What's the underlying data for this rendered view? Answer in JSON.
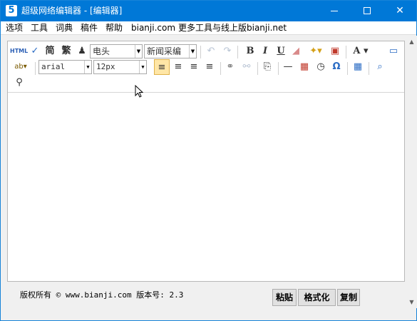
{
  "window": {
    "title": "超级网络编辑器 - [编辑器]",
    "app_icon_glyph": "5",
    "minimize_icon": "minimize-icon",
    "maximize_icon": "maximize-icon",
    "close_glyph": "✕"
  },
  "menubar": {
    "items": [
      "选项",
      "工具",
      "词典",
      "稿件",
      "帮助",
      "bianji.com",
      "更多工具与线上版bianji.net"
    ]
  },
  "toolbar": {
    "html_label": "HTML",
    "jian_label": "简",
    "fan_label": "繁",
    "font_select": "电头",
    "style_select": "新闻采编",
    "bold_label": "B",
    "italic_label": "I",
    "underline_label": "U",
    "font_color_label": "A",
    "spell_label": "ab",
    "font_family_select": "arial",
    "font_size_select": "12px",
    "omega_label": "Ω",
    "icons": [
      "html-icon",
      "spellcheck-icon",
      "simplified-icon",
      "traditional-icon",
      "stamp-icon",
      "undo-icon",
      "redo-icon",
      "eraser-icon",
      "magic-wand-icon",
      "paste-icon",
      "preview-icon",
      "align-left-icon",
      "align-center-icon",
      "align-right-icon",
      "justify-icon",
      "link-icon",
      "unlink-icon",
      "page-break-icon",
      "horizontal-rule-icon",
      "calendar-icon",
      "clock-icon",
      "special-char-icon",
      "table-icon",
      "find-icon",
      "binoculars-icon"
    ],
    "accent_color": "#ffe6a6"
  },
  "footer": {
    "copyright": "版权所有 © www.bianji.com 版本号: 2.3",
    "paste_button": "粘贴",
    "format_button": "格式化",
    "copy_button": "复制"
  },
  "colors": {
    "titlebar": "#0078d7",
    "background": "#f0f0f0"
  }
}
